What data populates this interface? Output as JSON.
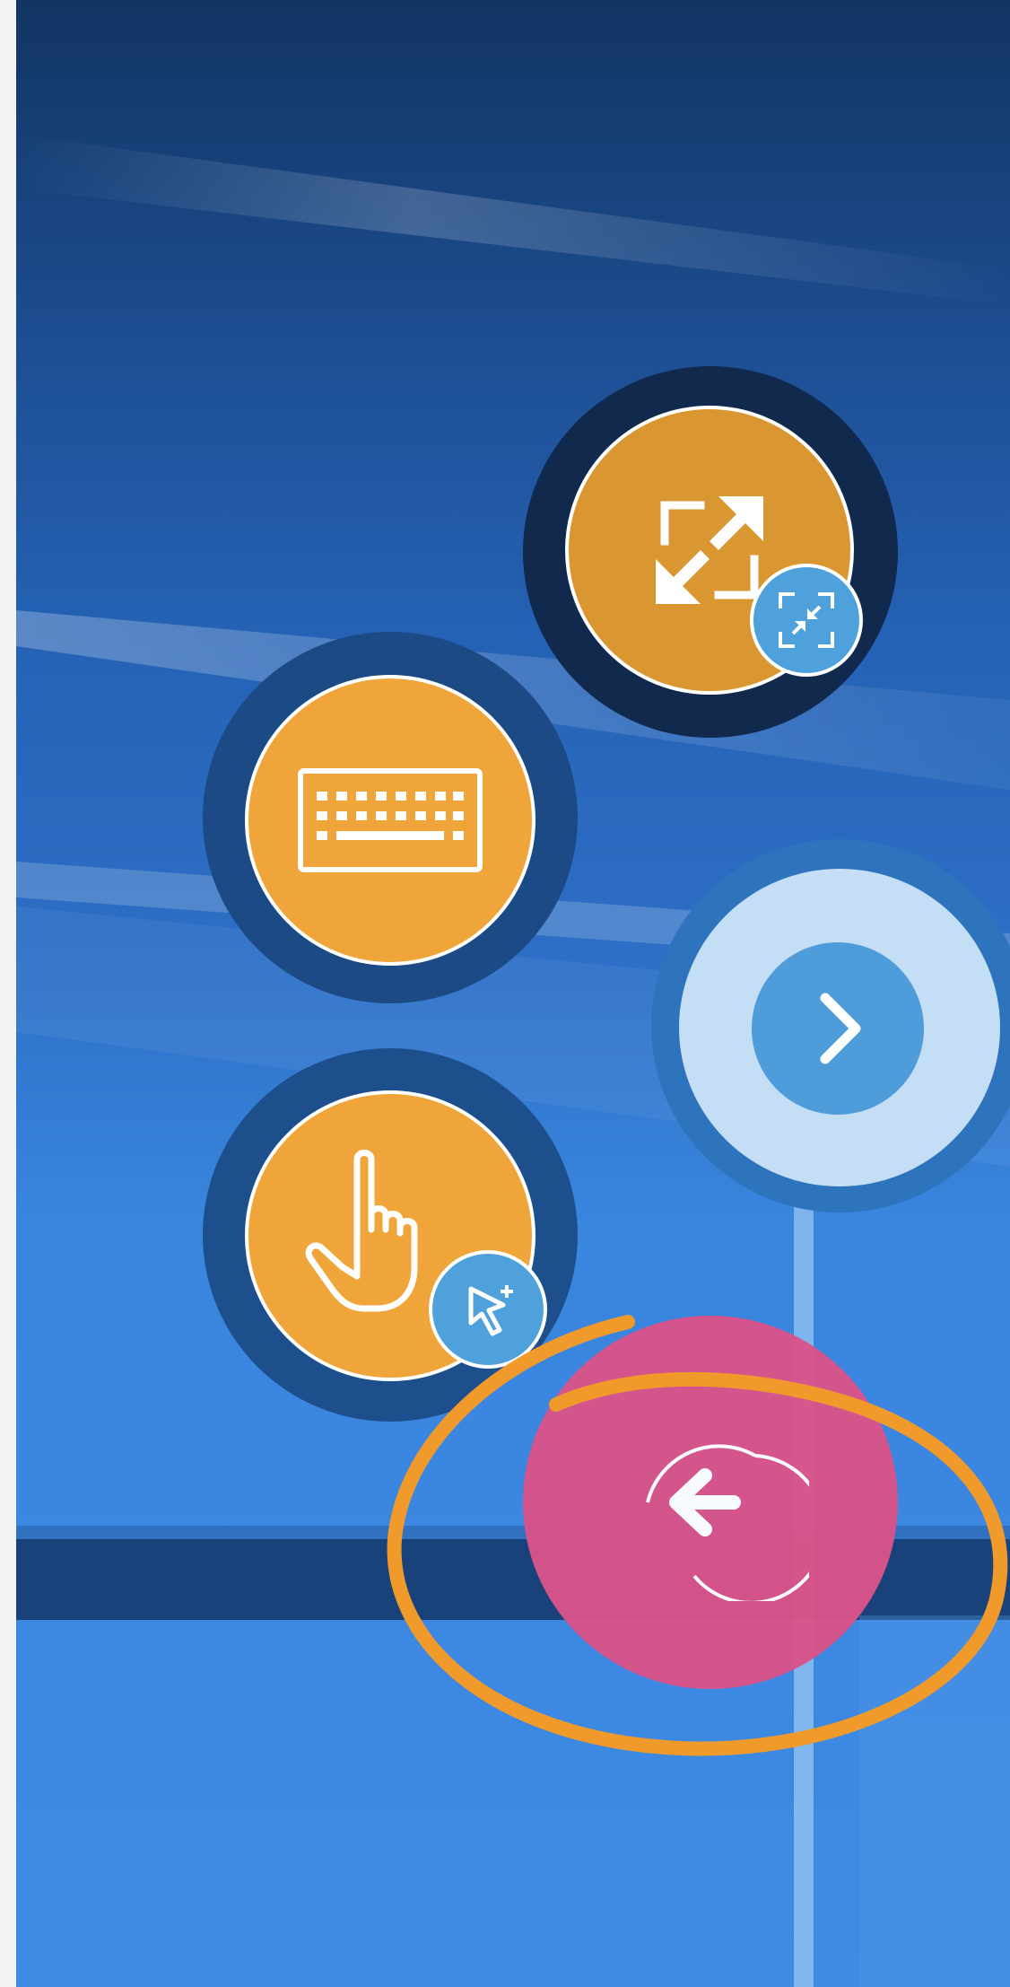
{
  "screen": {
    "description_free": true
  },
  "controls": {
    "fit_screen": {
      "icon": "fit-screen-icon",
      "badge_icon": "collapse-screen-icon",
      "color": "#d99631"
    },
    "keyboard": {
      "icon": "keyboard-icon",
      "color": "#f0a53a"
    },
    "next": {
      "icon": "chevron-right-icon",
      "color": "#4e9cd9"
    },
    "touch_mode": {
      "icon": "hand-pointer-icon",
      "badge_icon": "mouse-cursor-icon",
      "color": "#f0a53a"
    },
    "exit": {
      "icon": "exit-arrow-icon",
      "color": "#d9538a"
    }
  },
  "colors": {
    "wallpaper_top": "#123563",
    "wallpaper_bottom": "#3d8be4",
    "highlight": "#f09a2c",
    "badge": "#4fa1dc"
  }
}
